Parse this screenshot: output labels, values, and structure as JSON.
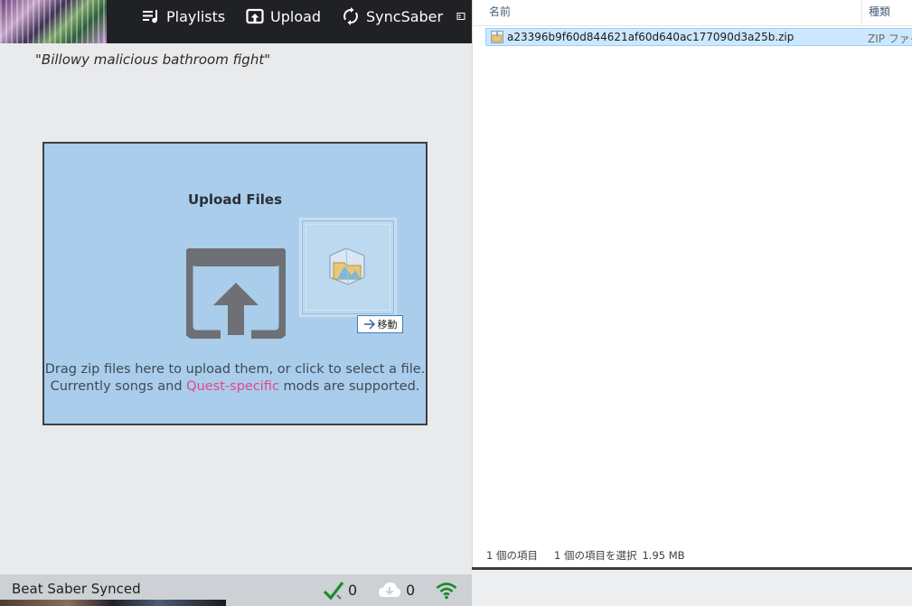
{
  "nav": {
    "items": [
      {
        "label": "Playlists",
        "icon": "playlist-icon"
      },
      {
        "label": "Upload",
        "icon": "upload-icon"
      },
      {
        "label": "SyncSaber",
        "icon": "sync-icon"
      }
    ]
  },
  "song_quote": "\"Billowy malicious bathroom fight\"",
  "upload": {
    "title": "Upload Files",
    "line1": "Drag zip files here to upload them, or click to select a file.",
    "line2_prefix": "Currently songs and ",
    "line2_link": "Quest-specific",
    "line2_suffix": " mods are supported.",
    "drag_action": "移動",
    "link_color": "#e3468e"
  },
  "status_bar": {
    "app_name": "Beat Saber Synced",
    "synced_count": "0",
    "download_count": "0"
  },
  "explorer": {
    "columns": {
      "name": "名前",
      "type": "種類"
    },
    "files": [
      {
        "name": "a23396b9f60d844621af60d640ac177090d3a25b.zip",
        "type": "ZIP ファイル",
        "selected": true
      }
    ],
    "status": {
      "item_count": "1 個の項目",
      "selection": "1 個の項目を選択",
      "size": "1.95 MB"
    }
  },
  "colors": {
    "topbar": "#202125",
    "dropzone": "#a9cdea",
    "selection": "#cce8ff",
    "check": "#1e8a2c",
    "wifi": "#1e8a2c"
  }
}
